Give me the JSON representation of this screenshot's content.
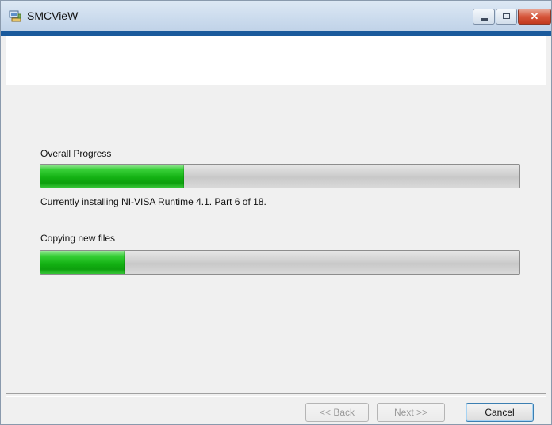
{
  "window": {
    "title": "SMCVieW",
    "app_icon": "installer-icon",
    "caption_buttons": {
      "minimize_icon": "minimize-icon",
      "maximize_icon": "maximize-icon",
      "close_icon": "close-icon",
      "close_glyph": "✕"
    }
  },
  "colors": {
    "title_strip": "#1a5a9c",
    "progress_fill": "#14b214",
    "progress_track": "#cfcfcf",
    "close_button": "#d6553a"
  },
  "main": {
    "overall": {
      "label": "Overall Progress",
      "progress_percent": 30,
      "status": "Currently installing NI-VISA Runtime 4.1.  Part 6 of 18."
    },
    "current": {
      "label": "Copying new files",
      "progress_percent": 17.5
    }
  },
  "footer": {
    "back_label": "<< Back",
    "next_label": "Next >>",
    "cancel_label": "Cancel"
  }
}
